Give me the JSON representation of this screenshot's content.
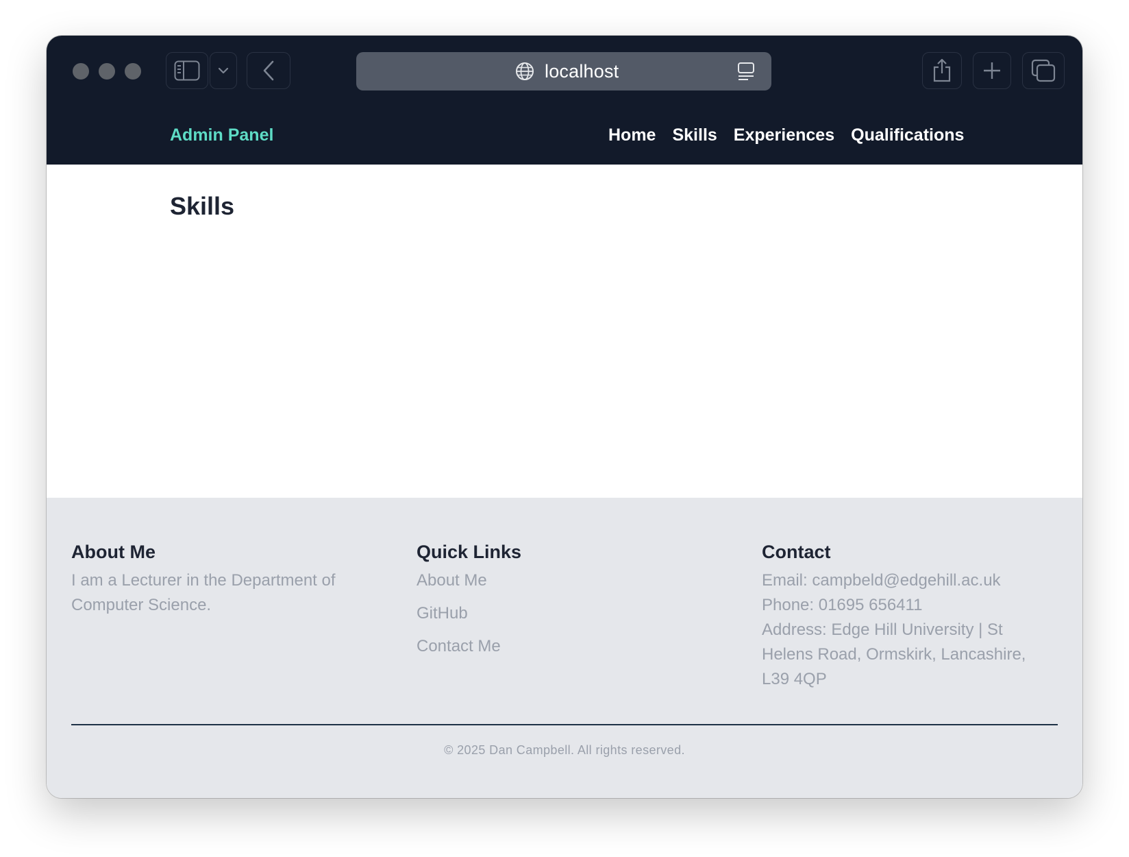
{
  "browser": {
    "url": "localhost"
  },
  "nav": {
    "brand": "Admin Panel",
    "links": [
      "Home",
      "Skills",
      "Experiences",
      "Qualifications"
    ]
  },
  "main": {
    "title": "Skills"
  },
  "footer": {
    "about": {
      "heading": "About Me",
      "text": "I am a Lecturer in the Department of Computer Science."
    },
    "quick_links": {
      "heading": "Quick Links",
      "links": [
        "About Me",
        "GitHub",
        "Contact Me"
      ]
    },
    "contact": {
      "heading": "Contact",
      "email": "Email: campbeld@edgehill.ac.uk",
      "phone": "Phone: 01695 656411",
      "address": "Address: Edge Hill University | St Helens Road, Ormskirk, Lancashire, L39 4QP"
    },
    "copyright": "© 2025 Dan Campbell. All rights reserved."
  },
  "colors": {
    "nav_background": "#121a2a",
    "brand_accent": "#5edcc6",
    "footer_background": "#e5e7eb",
    "footer_text": "#9aa0ab"
  }
}
